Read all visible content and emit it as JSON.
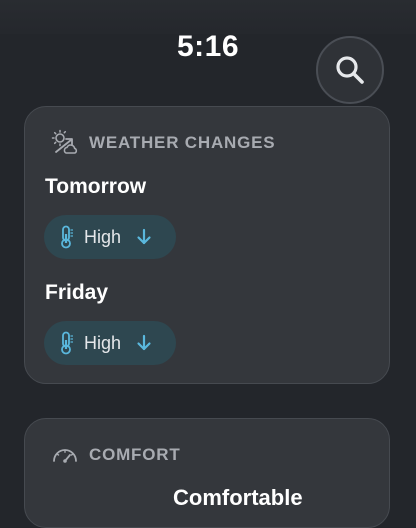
{
  "status_bar": {
    "time": "5:16"
  },
  "weather_card": {
    "title": "WEATHER CHANGES",
    "days": [
      {
        "day": "Tomorrow",
        "chip_label": "High",
        "trend": "down"
      },
      {
        "day": "Friday",
        "chip_label": "High",
        "trend": "down"
      }
    ]
  },
  "comfort_card": {
    "title": "COMFORT",
    "value": "Comfortable"
  },
  "colors": {
    "background": "#23262b",
    "card": "#34373c",
    "chip": "#2e4750",
    "accent": "#5ab8dd",
    "header_text": "#a8abb1"
  },
  "icons": [
    "search-icon",
    "weather-changes-icon",
    "thermometer-icon",
    "arrow-down-icon",
    "gauge-icon"
  ]
}
